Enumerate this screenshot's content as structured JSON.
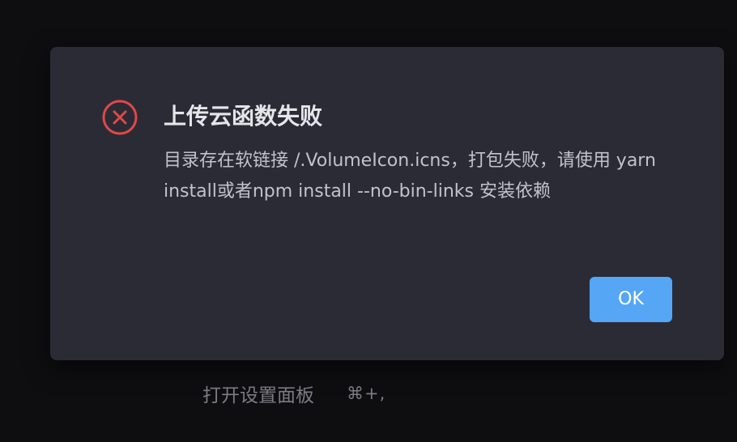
{
  "dialog": {
    "icon": "error-circle-x-icon",
    "title": "上传云函数失败",
    "message": "目录存在软链接 /.VolumeIcon.icns，打包失败，请使用 yarn install或者npm install --no-bin-links 安装依赖",
    "ok_label": "OK"
  },
  "background": {
    "shortcut_label": "打开设置面板",
    "shortcut_keys": "⌘+,"
  },
  "colors": {
    "page_background": "#0e0e10",
    "dialog_background": "#2b2b36",
    "error_red": "#e04848",
    "button_blue": "#55a7f5"
  }
}
